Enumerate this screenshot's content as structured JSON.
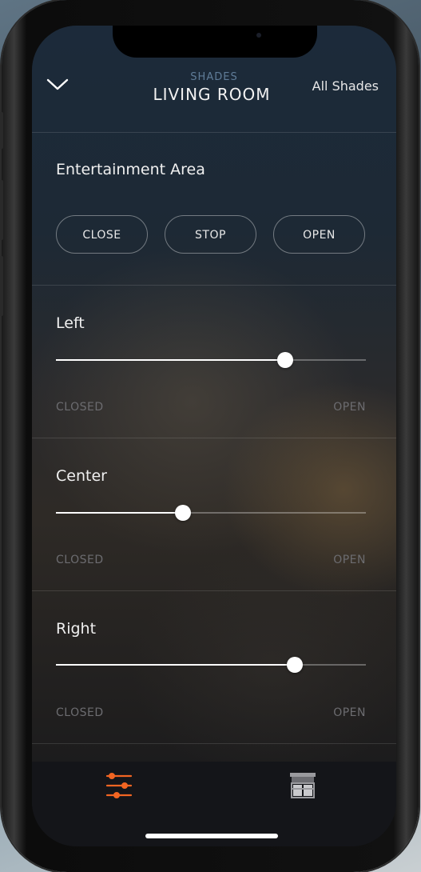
{
  "header": {
    "category": "SHADES",
    "room": "LIVING ROOM",
    "all_shades": "All Shades",
    "back_icon": "chevron-down-icon"
  },
  "group": {
    "title": "Entertainment Area",
    "buttons": [
      "CLOSE",
      "STOP",
      "OPEN"
    ]
  },
  "shades": [
    {
      "name": "Left",
      "position_fraction": 0.74,
      "min_label": "CLOSED",
      "max_label": "OPEN"
    },
    {
      "name": "Center",
      "position_fraction": 0.41,
      "min_label": "CLOSED",
      "max_label": "OPEN"
    },
    {
      "name": "Right",
      "position_fraction": 0.77,
      "min_label": "CLOSED",
      "max_label": "OPEN"
    }
  ],
  "tabbar": {
    "tabs": [
      {
        "icon": "sliders-icon",
        "active": true
      },
      {
        "icon": "shade-window-icon",
        "active": false
      }
    ]
  },
  "colors": {
    "accent": "#f26522",
    "title_blue": "#5f7c98"
  }
}
